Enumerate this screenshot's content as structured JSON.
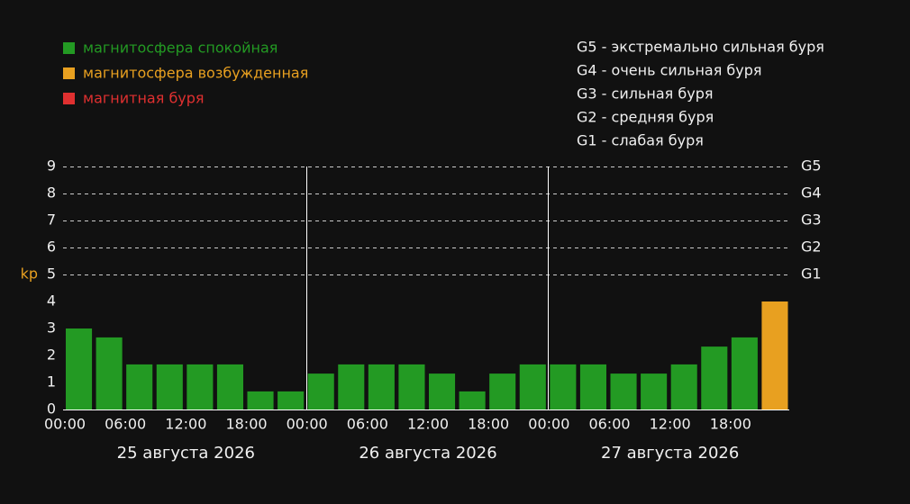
{
  "chart_data": {
    "type": "bar",
    "ylabel": "kp",
    "ylim": [
      0,
      9
    ],
    "yticks": [
      "0",
      "1",
      "2",
      "3",
      "4",
      "5",
      "6",
      "7",
      "8",
      "9"
    ],
    "g_levels": [
      {
        "label": "G1",
        "kp": 5
      },
      {
        "label": "G2",
        "kp": 6
      },
      {
        "label": "G3",
        "kp": 7
      },
      {
        "label": "G4",
        "kp": 8
      },
      {
        "label": "G5",
        "kp": 9
      }
    ],
    "grid": "dashed at G levels",
    "bar_slots": 24,
    "x_tick_labels": [
      "00:00",
      "06:00",
      "12:00",
      "18:00",
      "00:00",
      "06:00",
      "12:00",
      "18:00",
      "00:00",
      "06:00",
      "12:00",
      "18:00"
    ],
    "x_tick_slots": [
      0,
      2,
      4,
      6,
      8,
      10,
      12,
      14,
      16,
      18,
      20,
      22
    ],
    "day_labels": [
      "25 августа 2026",
      "26 августа 2026",
      "27 августа 2026"
    ],
    "day_separator_slots": [
      8,
      16
    ],
    "values": [
      3.0,
      2.67,
      1.67,
      1.67,
      1.67,
      1.67,
      0.67,
      0.67,
      1.33,
      1.67,
      1.67,
      1.67,
      1.33,
      0.67,
      1.33,
      1.67,
      1.67,
      1.67,
      1.33,
      1.33,
      1.67,
      2.33,
      2.67,
      4.0
    ],
    "categories": [
      "quiet",
      "quiet",
      "quiet",
      "quiet",
      "quiet",
      "quiet",
      "quiet",
      "quiet",
      "quiet",
      "quiet",
      "quiet",
      "quiet",
      "quiet",
      "quiet",
      "quiet",
      "quiet",
      "quiet",
      "quiet",
      "quiet",
      "quiet",
      "quiet",
      "quiet",
      "quiet",
      "active"
    ],
    "legend": [
      {
        "key": "quiet",
        "label": "магнитосфера спокойная",
        "color": "#239a23"
      },
      {
        "key": "active",
        "label": "магнитосфера возбужденная",
        "color": "#e8a020"
      },
      {
        "key": "storm",
        "label": "магнитная буря",
        "color": "#e03030"
      }
    ],
    "scale_legend": [
      "G5 - экстремально сильная буря",
      "G4 - очень сильная буря",
      "G3 - сильная буря",
      "G2 - средняя буря",
      "G1 - слабая буря"
    ],
    "legend_placement": "top"
  },
  "colors": {
    "background": "#111111",
    "text": "#f0f0f0",
    "grid": "#cccccc",
    "axis": "#ffffff",
    "ylabel": "#e8a020"
  }
}
